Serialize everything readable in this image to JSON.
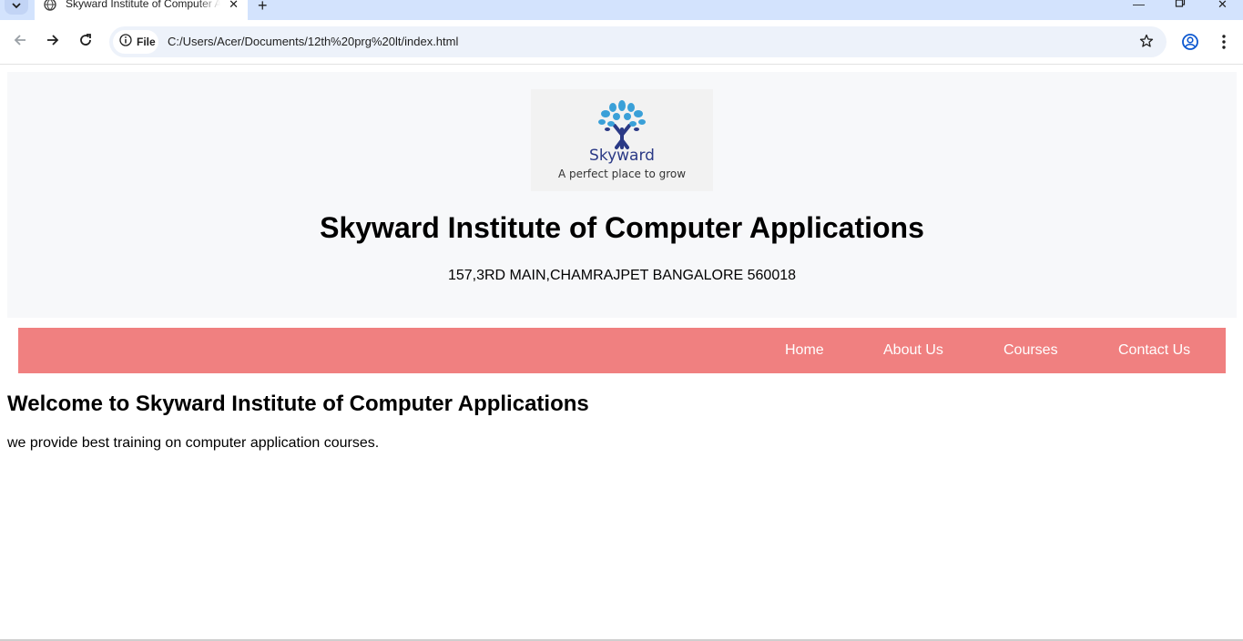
{
  "browser": {
    "tab_title": "Skyward Institute of Computer Applications",
    "url_chip": "File",
    "url": "C:/Users/Acer/Documents/12th%20prg%20lt/index.html"
  },
  "header": {
    "logo": {
      "name": "Skyward",
      "tagline": "A perfect place to grow"
    },
    "title": "Skyward Institute of Computer Applications",
    "address": "157,3RD MAIN,CHAMRAJPET BANGALORE 560018"
  },
  "nav": {
    "items": [
      {
        "label": "Home"
      },
      {
        "label": "About Us"
      },
      {
        "label": "Courses"
      },
      {
        "label": "Contact Us"
      }
    ]
  },
  "main": {
    "heading": "Welcome to Skyward Institute of Computer Applications",
    "text": "we provide best training on computer application courses."
  },
  "colors": {
    "nav_bg": "#f08080",
    "header_bg": "#f7f8fa",
    "logo_blue": "#2b3a86",
    "leaf_blue": "#3aa0d8",
    "chrome_tabstrip": "#d3e3fd"
  }
}
